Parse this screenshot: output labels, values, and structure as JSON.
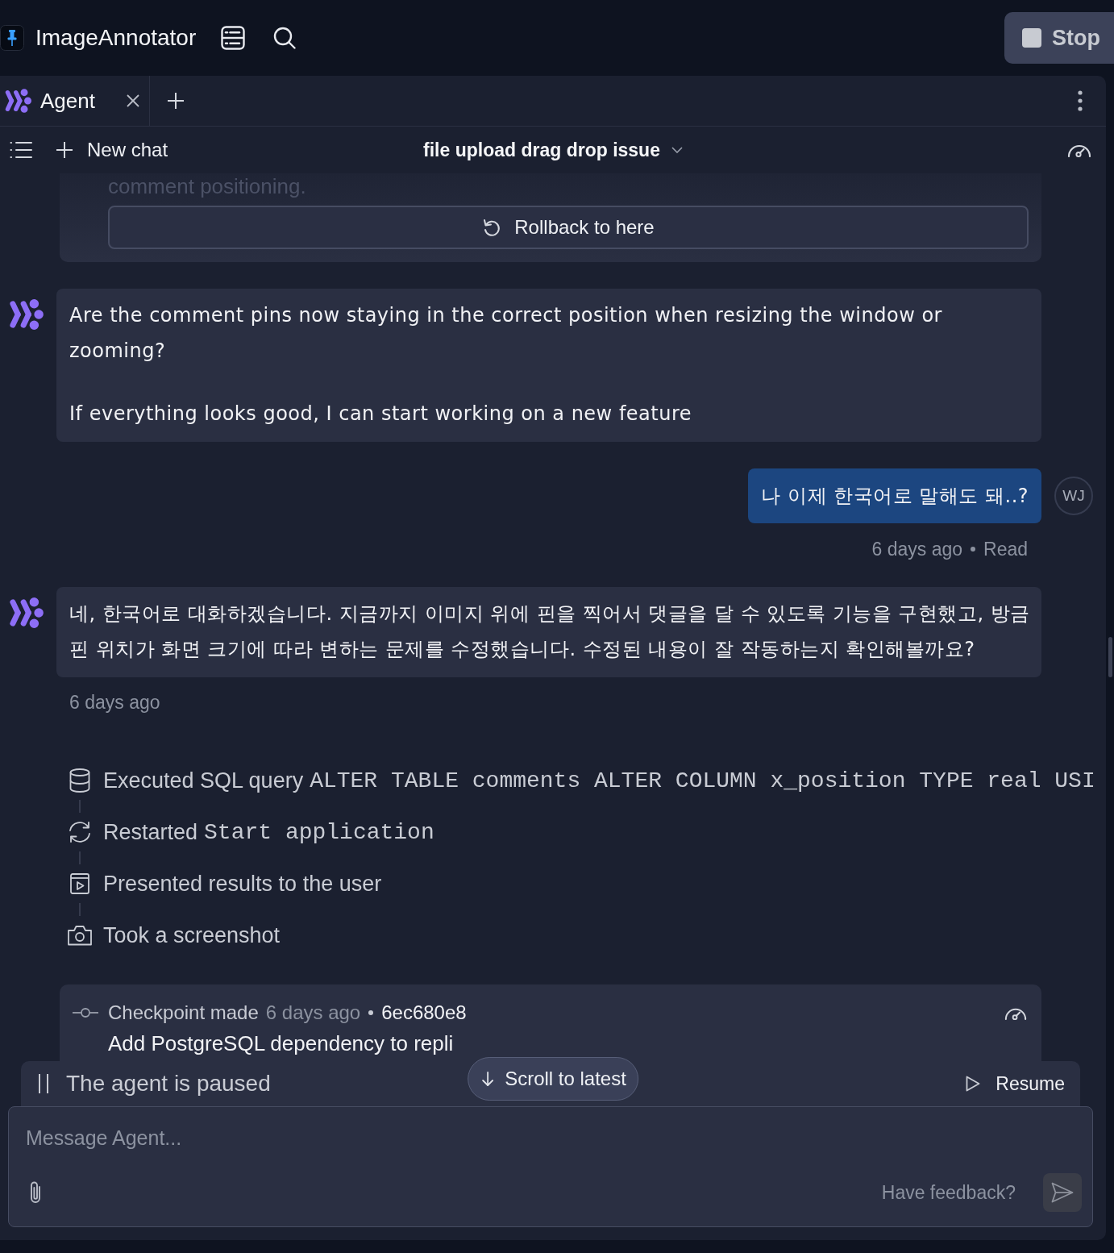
{
  "top_bar": {
    "app_name": "ImageAnnotator",
    "stop_label": "Stop"
  },
  "tabs": [
    {
      "label": "Agent",
      "selected": true
    }
  ],
  "chat_header": {
    "new_chat": "New chat",
    "title": "file upload drag drop issue"
  },
  "messages": [
    {
      "kind": "checkpoint_end",
      "text": "comment positioning.",
      "rollback": "Rollback to here"
    },
    {
      "kind": "agent",
      "paragraphs": [
        "Are the comment pins now staying in the correct position when resizing the window or zooming?",
        "If everything looks good, I can start working on a new feature"
      ]
    },
    {
      "kind": "user",
      "text": "나 이제 한국어로 말해도 돼..?",
      "avatar": "WJ",
      "time": "6 days ago",
      "status": "Read"
    },
    {
      "kind": "agent",
      "paragraphs": [
        "네, 한국어로 대화하겠습니다. 지금까지 이미지 위에 핀을 찍어서 댓글을 달 수 있도록 기능을 구현했고, 방금 핀 위치가 화면 크기에 따라 변하는 문제를 수정했습니다. 수정된 내용이 잘 작동하는지 확인해볼까요?"
      ],
      "time": "6 days ago"
    },
    {
      "kind": "activity",
      "steps": [
        {
          "kind": "sql",
          "label": "Executed SQL query",
          "code": "ALTER TABLE comments ALTER COLUMN x_position TYPE real USI"
        },
        {
          "kind": "restart",
          "label": "Restarted",
          "code": "Start application"
        },
        {
          "kind": "present",
          "label": "Presented results to the user"
        },
        {
          "kind": "screenshot",
          "label": "Took a screenshot"
        }
      ]
    },
    {
      "kind": "checkpoint",
      "label": "Checkpoint made",
      "time": "6 days ago",
      "hash": "6ec680e8",
      "text": "Add PostgreSQL dependency to repli"
    }
  ],
  "scroll_button": "Scroll to latest",
  "paused_bar": {
    "text": "The agent is paused",
    "resume": "Resume"
  },
  "composer": {
    "placeholder": "Message Agent...",
    "feedback": "Have feedback?"
  }
}
